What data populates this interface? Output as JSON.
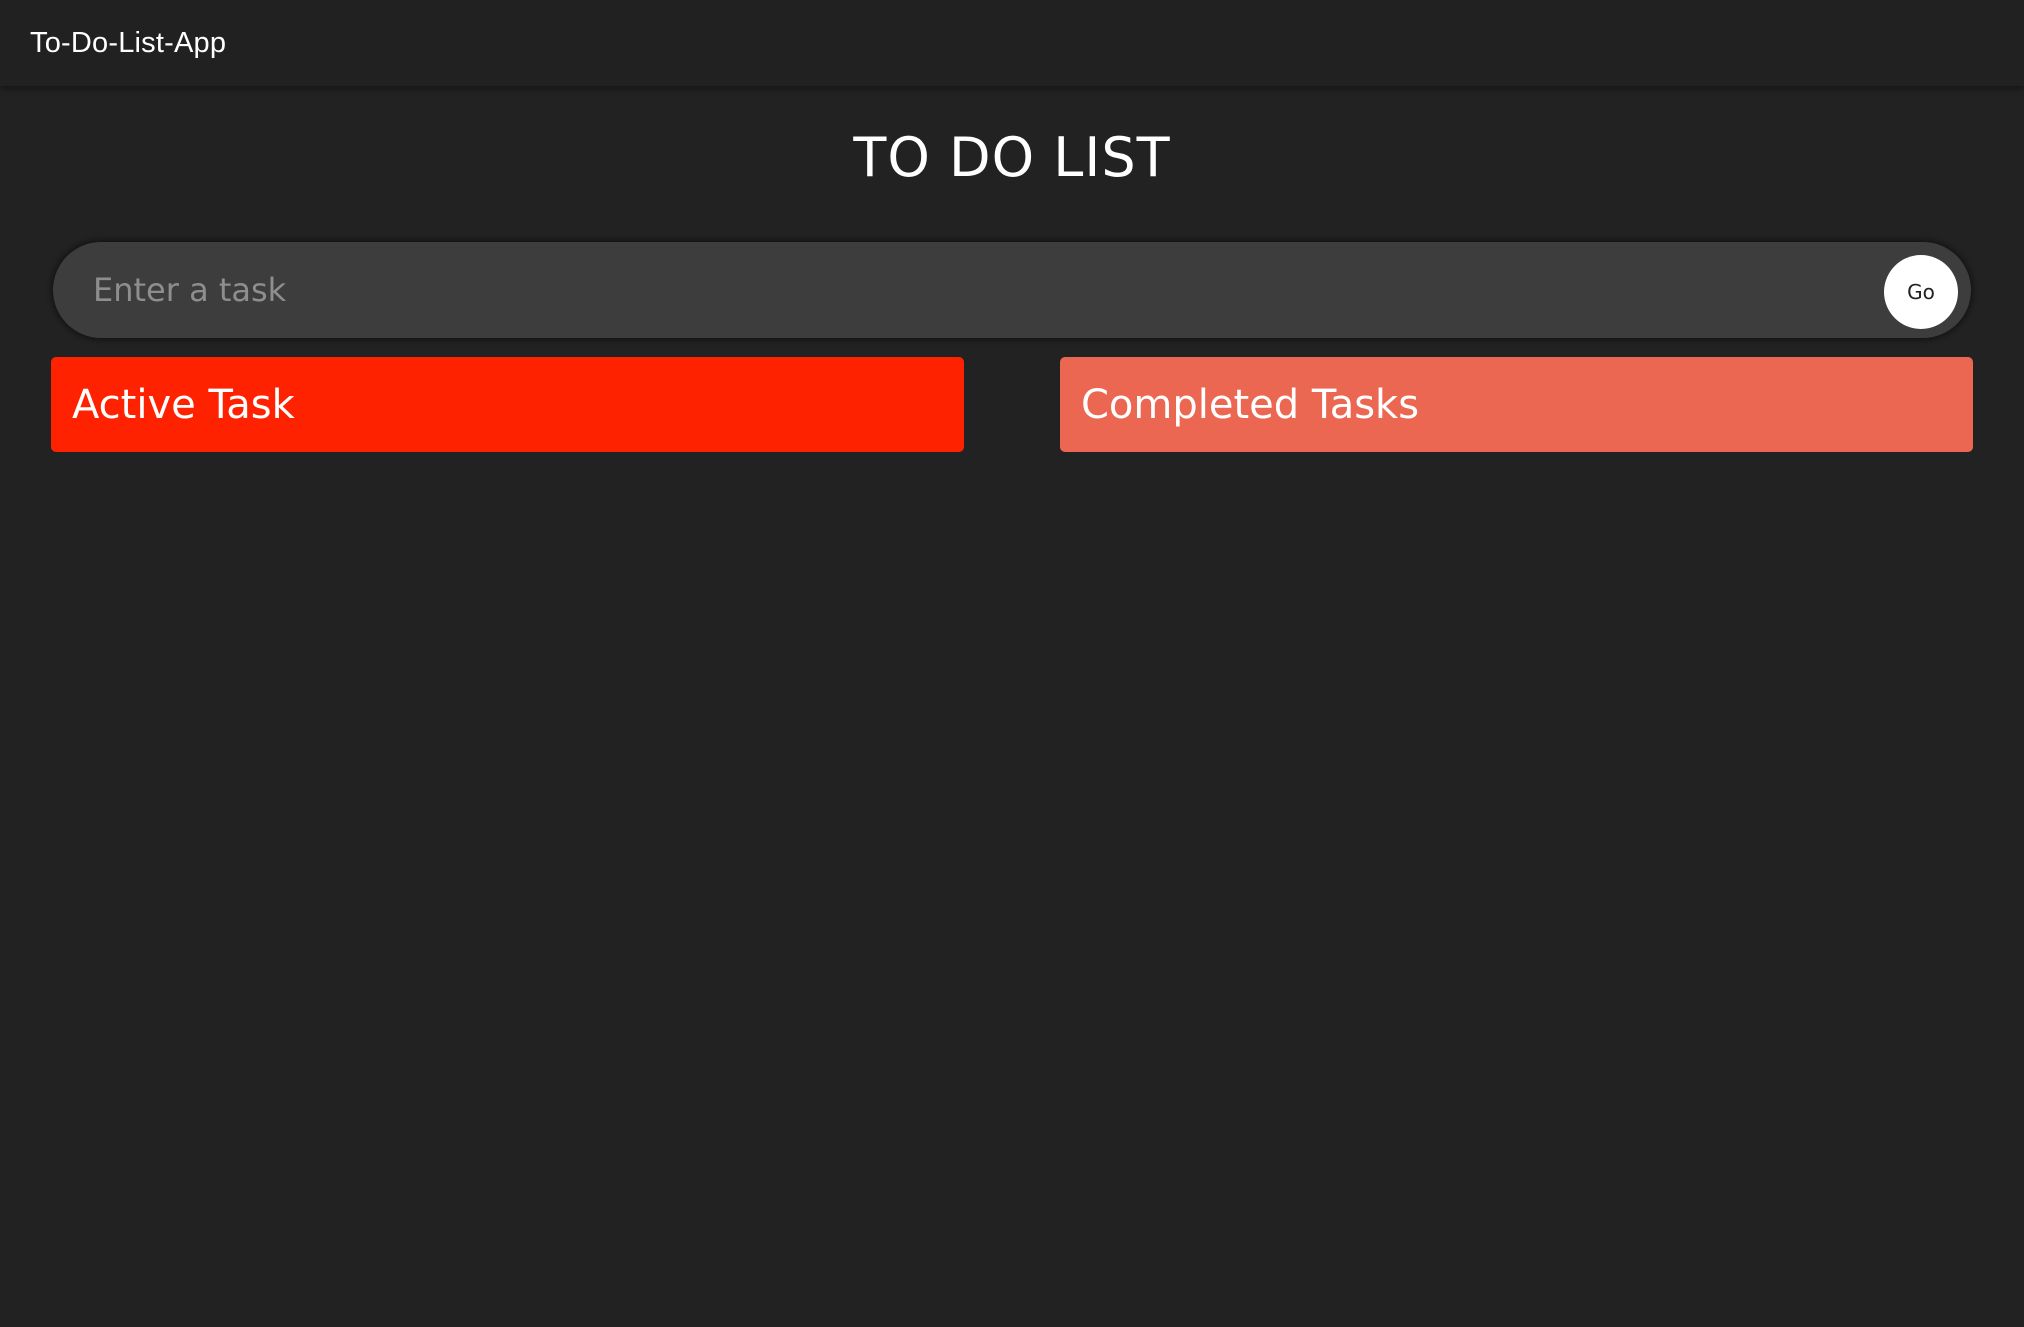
{
  "app_bar": {
    "title": "To-Do-List-App"
  },
  "page": {
    "heading": "TO DO LIST"
  },
  "task_form": {
    "placeholder": "Enter a task",
    "value": "",
    "submit_label": "Go"
  },
  "columns": {
    "active": {
      "label": "Active Task",
      "color": "#ff2200"
    },
    "completed": {
      "label": "Completed Tasks",
      "color": "#ec6752"
    }
  },
  "colors": {
    "background": "#222222",
    "app_bar": "#212121",
    "input_background": "#3d3d3d",
    "placeholder": "#8e8e8e"
  }
}
